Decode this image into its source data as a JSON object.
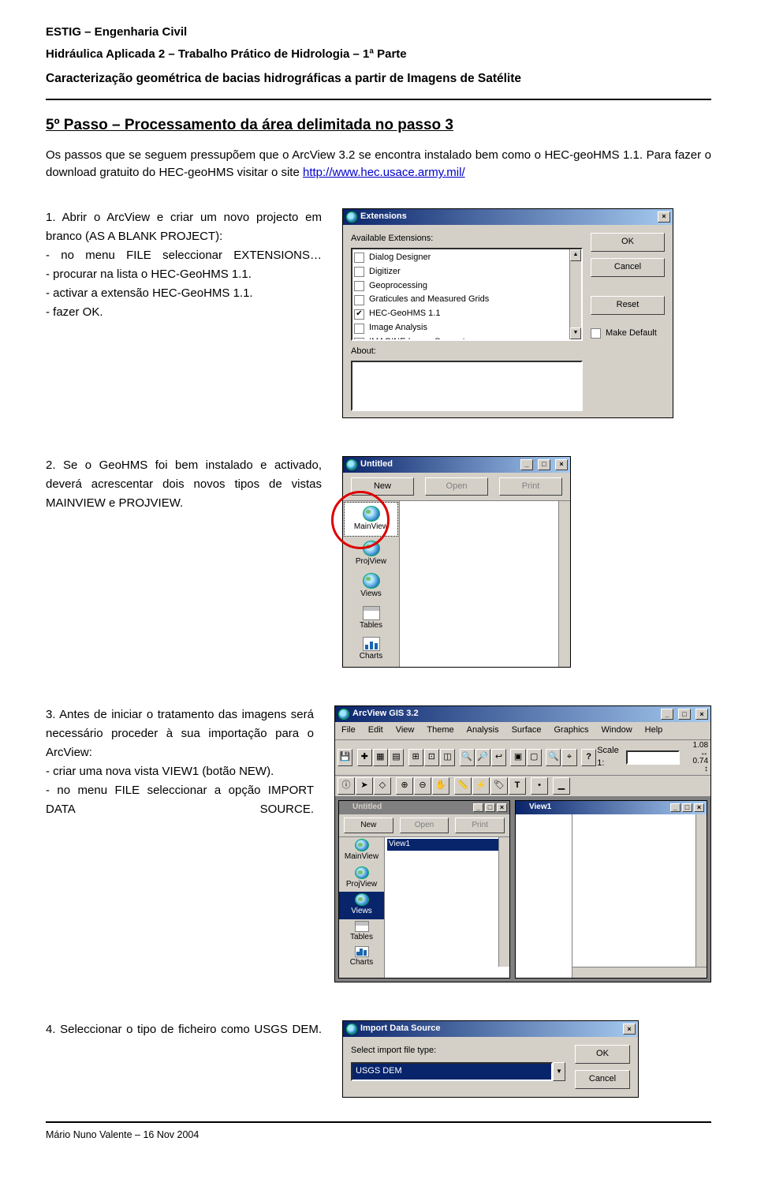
{
  "header": {
    "line1": "ESTIG – Engenharia Civil",
    "line2": "Hidráulica Aplicada 2 – Trabalho Prático de Hidrologia – 1ª Parte",
    "line3": "Caracterização geométrica de bacias hidrográficas a partir de Imagens de Satélite"
  },
  "step_title": "5º Passo – Processamento da área delimitada no passo 3",
  "intro": {
    "sentence1": "Os passos que se seguem pressupõem que o ArcView 3.2 se encontra instalado bem como o HEC-geoHMS 1.1. Para fazer o download gratuito do HEC-geoHMS visitar o site ",
    "link": "http://www.hec.usace.army.mil/"
  },
  "block1": {
    "lead": "1. Abrir o ArcView e criar um novo projecto em branco (AS A BLANK PROJECT):",
    "b1": "- no menu FILE seleccionar EXTENSIONS…",
    "b2": "- procurar na lista o HEC-GeoHMS 1.1.",
    "b3": "- activar a extensão HEC-GeoHMS 1.1.",
    "b4": "- fazer OK."
  },
  "block2": {
    "text": "2. Se o GeoHMS foi bem instalado e activado, deverá acrescentar dois novos tipos de vistas MAINVIEW e PROJVIEW."
  },
  "block3": {
    "lead": "3. Antes de iniciar o tratamento das imagens será necessário proceder à sua importação para o ArcView:",
    "b1": "- criar uma nova vista VIEW1 (botão NEW).",
    "b2": "- no menu FILE seleccionar a opção IMPORT DATA SOURCE."
  },
  "block4": {
    "text": "4. Seleccionar o tipo de ficheiro como USGS DEM."
  },
  "ext_dialog": {
    "title": "Extensions",
    "available": "Available Extensions:",
    "items": [
      "Dialog Designer",
      "Digitizer",
      "Geoprocessing",
      "Graticules and Measured Grids",
      "HEC-GeoHMS 1.1",
      "Image Analysis",
      "IMAGINE Image Support"
    ],
    "checked_index": 4,
    "about": "About:",
    "btn_ok": "OK",
    "btn_cancel": "Cancel",
    "btn_reset": "Reset",
    "make_default": "Make Default"
  },
  "proj_win": {
    "title": "Untitled",
    "btn_new": "New",
    "btn_open": "Open",
    "btn_print": "Print",
    "side": [
      "MainView",
      "ProjView",
      "Views",
      "Tables",
      "Charts"
    ]
  },
  "av_win": {
    "title": "ArcView GIS 3.2",
    "menu": [
      "File",
      "Edit",
      "View",
      "Theme",
      "Analysis",
      "Surface",
      "Graphics",
      "Window",
      "Help"
    ],
    "scale_label": "Scale 1:",
    "coord_top": "1.08",
    "coord_bot": "0.74",
    "sub1": {
      "title": "Untitled",
      "btn_new": "New",
      "btn_open": "Open",
      "btn_print": "Print",
      "side": [
        "MainView",
        "ProjView",
        "Views",
        "Tables",
        "Charts"
      ],
      "list_item": "View1"
    },
    "sub2": {
      "title": "View1"
    }
  },
  "import_dialog": {
    "title": "Import Data Source",
    "label": "Select import file type:",
    "value": "USGS DEM",
    "btn_ok": "OK",
    "btn_cancel": "Cancel"
  },
  "footer": "Mário Nuno Valente – 16 Nov 2004"
}
